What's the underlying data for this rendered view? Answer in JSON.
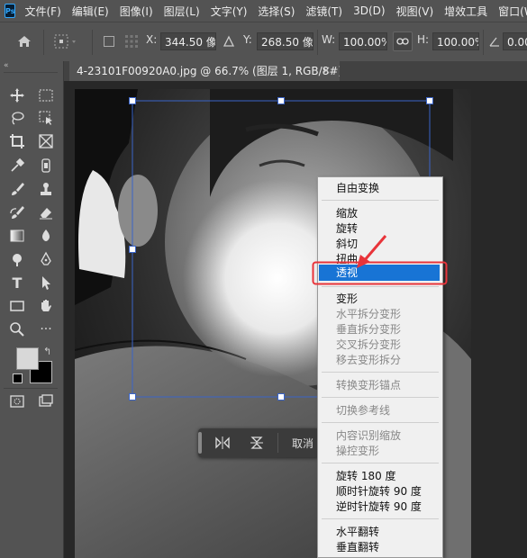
{
  "app": {
    "logo": "Ps"
  },
  "menubar": {
    "items": [
      "文件(F)",
      "编辑(E)",
      "图像(I)",
      "图层(L)",
      "文字(Y)",
      "选择(S)",
      "滤镜(T)",
      "3D(D)",
      "视图(V)",
      "增效工具",
      "窗口(W)"
    ]
  },
  "options": {
    "x_label": "X:",
    "x_value": "344.50 像素",
    "y_label": "Y:",
    "y_value": "268.50 像素",
    "w_label": "W:",
    "w_value": "100.00%",
    "h_label": "H:",
    "h_value": "100.00%",
    "angle_value": "0.00"
  },
  "document": {
    "tab_title": "4-23101F00920A0.jpg @ 66.7% (图层 1, RGB/8#) *",
    "close": "×"
  },
  "floatbar": {
    "cancel_label": "取消"
  },
  "context_menu": {
    "free_transform": "自由变换",
    "scale": "缩放",
    "rotate": "旋转",
    "skew": "斜切",
    "distort": "扭曲",
    "perspective": "透视",
    "warp": "变形",
    "split_h": "水平拆分变形",
    "split_v": "垂直拆分变形",
    "split_cross": "交叉拆分变形",
    "remove_split": "移去变形拆分",
    "convert_anchor": "转换变形锚点",
    "toggle_ref": "切换参考线",
    "content_scale": "内容识别缩放",
    "puppet_warp": "操控变形",
    "rot180": "旋转 180 度",
    "rot90cw": "顺时针旋转 90 度",
    "rot90ccw": "逆时针旋转 90 度",
    "flip_h": "水平翻转",
    "flip_v": "垂直翻转"
  },
  "colors": {
    "accent": "#1874d5",
    "highlight_box": "#e8343a",
    "handle_stroke": "#3a64c8"
  },
  "toolbar": {
    "tools": [
      "move-tool",
      "marquee-tool",
      "lasso-tool",
      "object-select-tool",
      "crop-tool",
      "frame-tool",
      "eyedropper-tool",
      "spot-heal-tool",
      "brush-tool",
      "stamp-tool",
      "history-brush-tool",
      "eraser-tool",
      "gradient-tool",
      "blur-tool",
      "dodge-tool",
      "pen-tool",
      "type-tool",
      "path-select-tool",
      "rectangle-tool",
      "hand-tool",
      "zoom-tool",
      "more-tool"
    ]
  }
}
